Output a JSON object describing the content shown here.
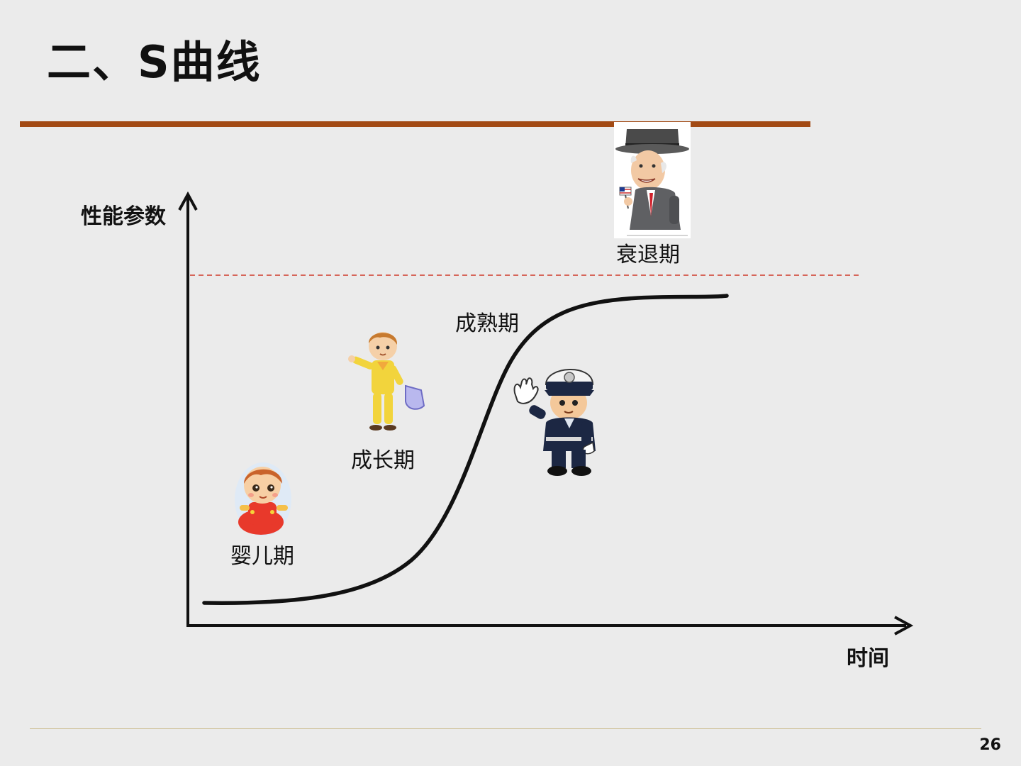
{
  "slide": {
    "title": "二、S曲线",
    "page_number": "26",
    "colors": {
      "background": "#ebebeb",
      "title_rule": "#a24a14",
      "curve": "#111111",
      "dashed_limit": "#d03a2a",
      "footer_rule": "#c9b98a"
    }
  },
  "diagram": {
    "y_axis_label": "性能参数",
    "x_axis_label": "时间",
    "stages": [
      {
        "label": "婴儿期",
        "icon": "baby-icon"
      },
      {
        "label": "成长期",
        "icon": "child-icon"
      },
      {
        "label": "成熟期",
        "icon": "police-officer-icon"
      },
      {
        "label": "衰退期",
        "icon": "old-man-icon"
      }
    ]
  }
}
